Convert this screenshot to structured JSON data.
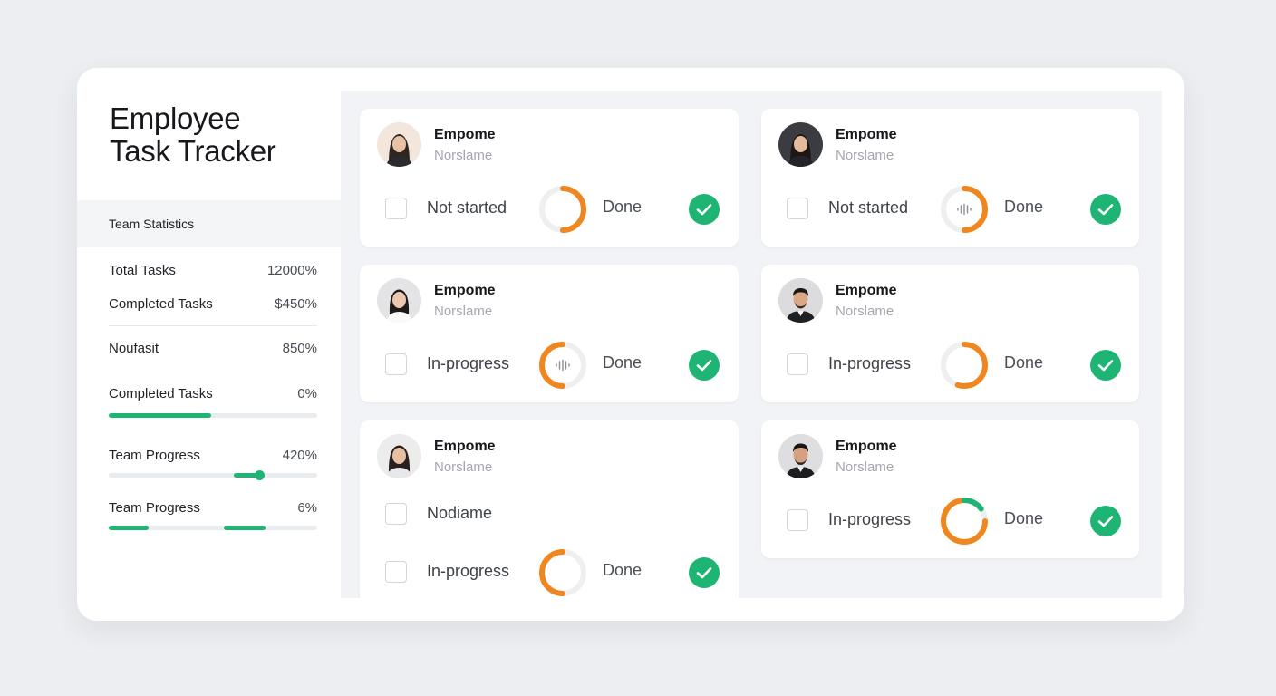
{
  "app": {
    "title_line1": "Employee",
    "title_line2": "Task Tracker"
  },
  "sidebar": {
    "stats_header": "Team Statistics",
    "stats": [
      {
        "label": "Total Tasks",
        "value": "12000%"
      },
      {
        "label": "Completed Tasks",
        "value": "$450%"
      },
      {
        "label": "Noufasit",
        "value": "850%"
      },
      {
        "label": "Completed Tasks",
        "value": "0%"
      },
      {
        "label": "Team Progress",
        "value": "420%"
      },
      {
        "label": "Team Progress",
        "value": "6%"
      }
    ],
    "progress": {
      "completed_tasks": 0.49,
      "team_progress_1": 0.72,
      "team_progress_2_segments": [
        [
          0,
          0.19
        ],
        [
          0.55,
          0.75
        ]
      ]
    }
  },
  "colors": {
    "accent_green": "#1eb574",
    "accent_orange": "#f0861f",
    "ring_gray": "#eeeff1"
  },
  "cards": [
    {
      "name": "Empome",
      "role": "Norslame",
      "avatar": "woman-avatar",
      "tasks": [
        {
          "status": "Not started",
          "done_label": "Done",
          "ring": "orange-ring",
          "ring_fill": 0.5,
          "done": true
        }
      ]
    },
    {
      "name": "Empome",
      "role": "Norslame",
      "avatar": "woman-avatar",
      "tasks": [
        {
          "status": "Not started",
          "done_label": "Done",
          "ring": "orange-ring-with-waveform",
          "ring_fill": 0.5,
          "done": true
        }
      ]
    },
    {
      "name": "Empome",
      "role": "Norslame",
      "avatar": "woman-avatar",
      "tasks": [
        {
          "status": "In-progress",
          "done_label": "Done",
          "ring": "orange-ring-with-waveform",
          "ring_fill": 0.5,
          "done": true
        }
      ]
    },
    {
      "name": "Empome",
      "role": "Norslame",
      "avatar": "man-avatar",
      "tasks": [
        {
          "status": "In-progress",
          "done_label": "Done",
          "ring": "orange-ring",
          "ring_fill": 0.55,
          "done": true
        }
      ]
    },
    {
      "name": "Empome",
      "role": "Norslame",
      "avatar": "woman-avatar",
      "tasks": [
        {
          "status": "Nodiame",
          "done_label": "",
          "ring": "",
          "ring_fill": 0,
          "done": false
        },
        {
          "status": "In-progress",
          "done_label": "Done",
          "ring": "orange-ring",
          "ring_fill": 0.5,
          "done": true
        }
      ]
    },
    {
      "name": "Empome",
      "role": "Norslame",
      "avatar": "man-avatar",
      "tasks": [
        {
          "status": "In-progress",
          "done_label": "Done",
          "ring": "orange-green-ring",
          "ring_fill": 0.75,
          "green_fill": 0.15,
          "done": true
        }
      ]
    }
  ]
}
